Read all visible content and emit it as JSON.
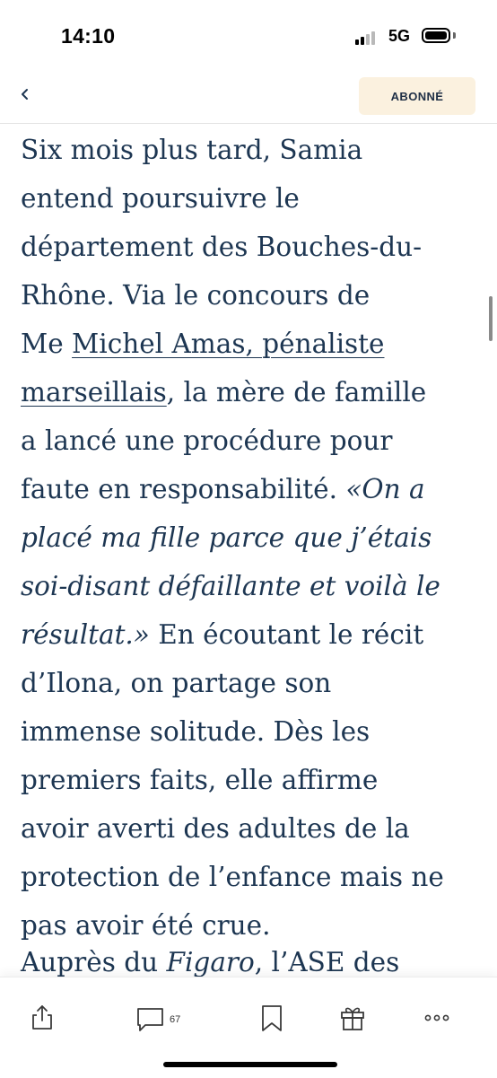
{
  "status_bar": {
    "time": "14:10",
    "network": "5G"
  },
  "nav": {
    "back_icon": "chevron-left-icon",
    "subscribe_label": "ABONNÉ",
    "subscribe_bg": "#fbf1df"
  },
  "article": {
    "text_color": "#1d3652",
    "paragraph_1": {
      "l1": "Six mois plus tard, Samia",
      "l2": "entend poursuivre le",
      "l3": "département des Bouches-du-",
      "l4": "Rhône. Via le concours de",
      "l5_prefix": "Me ",
      "link_part1": "Michel Amas, pénaliste",
      "link_part2": "marseillais",
      "l6_suffix": ", la mère de famille",
      "l7": "a lancé une procédure pour",
      "l8_plain": "faute en responsabilité. ",
      "quote_part1": "«On a",
      "quote_part2": "placé ma fille parce que j’étais",
      "quote_part3": "soi-disant défaillante et voilà le",
      "quote_part4": "résultat.»",
      "l11_suffix": " En écoutant le récit",
      "l12": "d’Ilona, on partage son",
      "l13": "immense solitude. Dès les",
      "l14": "premiers faits, elle affirme",
      "l15": "avoir averti des adultes de la",
      "l16": "protection de l’enfance mais ne",
      "l17": "pas avoir été crue."
    },
    "paragraph_2": {
      "prefix": "Auprès du ",
      "italic": "Figaro",
      "suffix": ", l’ASE des"
    }
  },
  "toolbar": {
    "share_icon": "share-icon",
    "comment_icon": "comment-icon",
    "comment_count": "67",
    "bookmark_icon": "bookmark-icon",
    "gift_icon": "gift-icon",
    "more_icon": "more-icon"
  }
}
